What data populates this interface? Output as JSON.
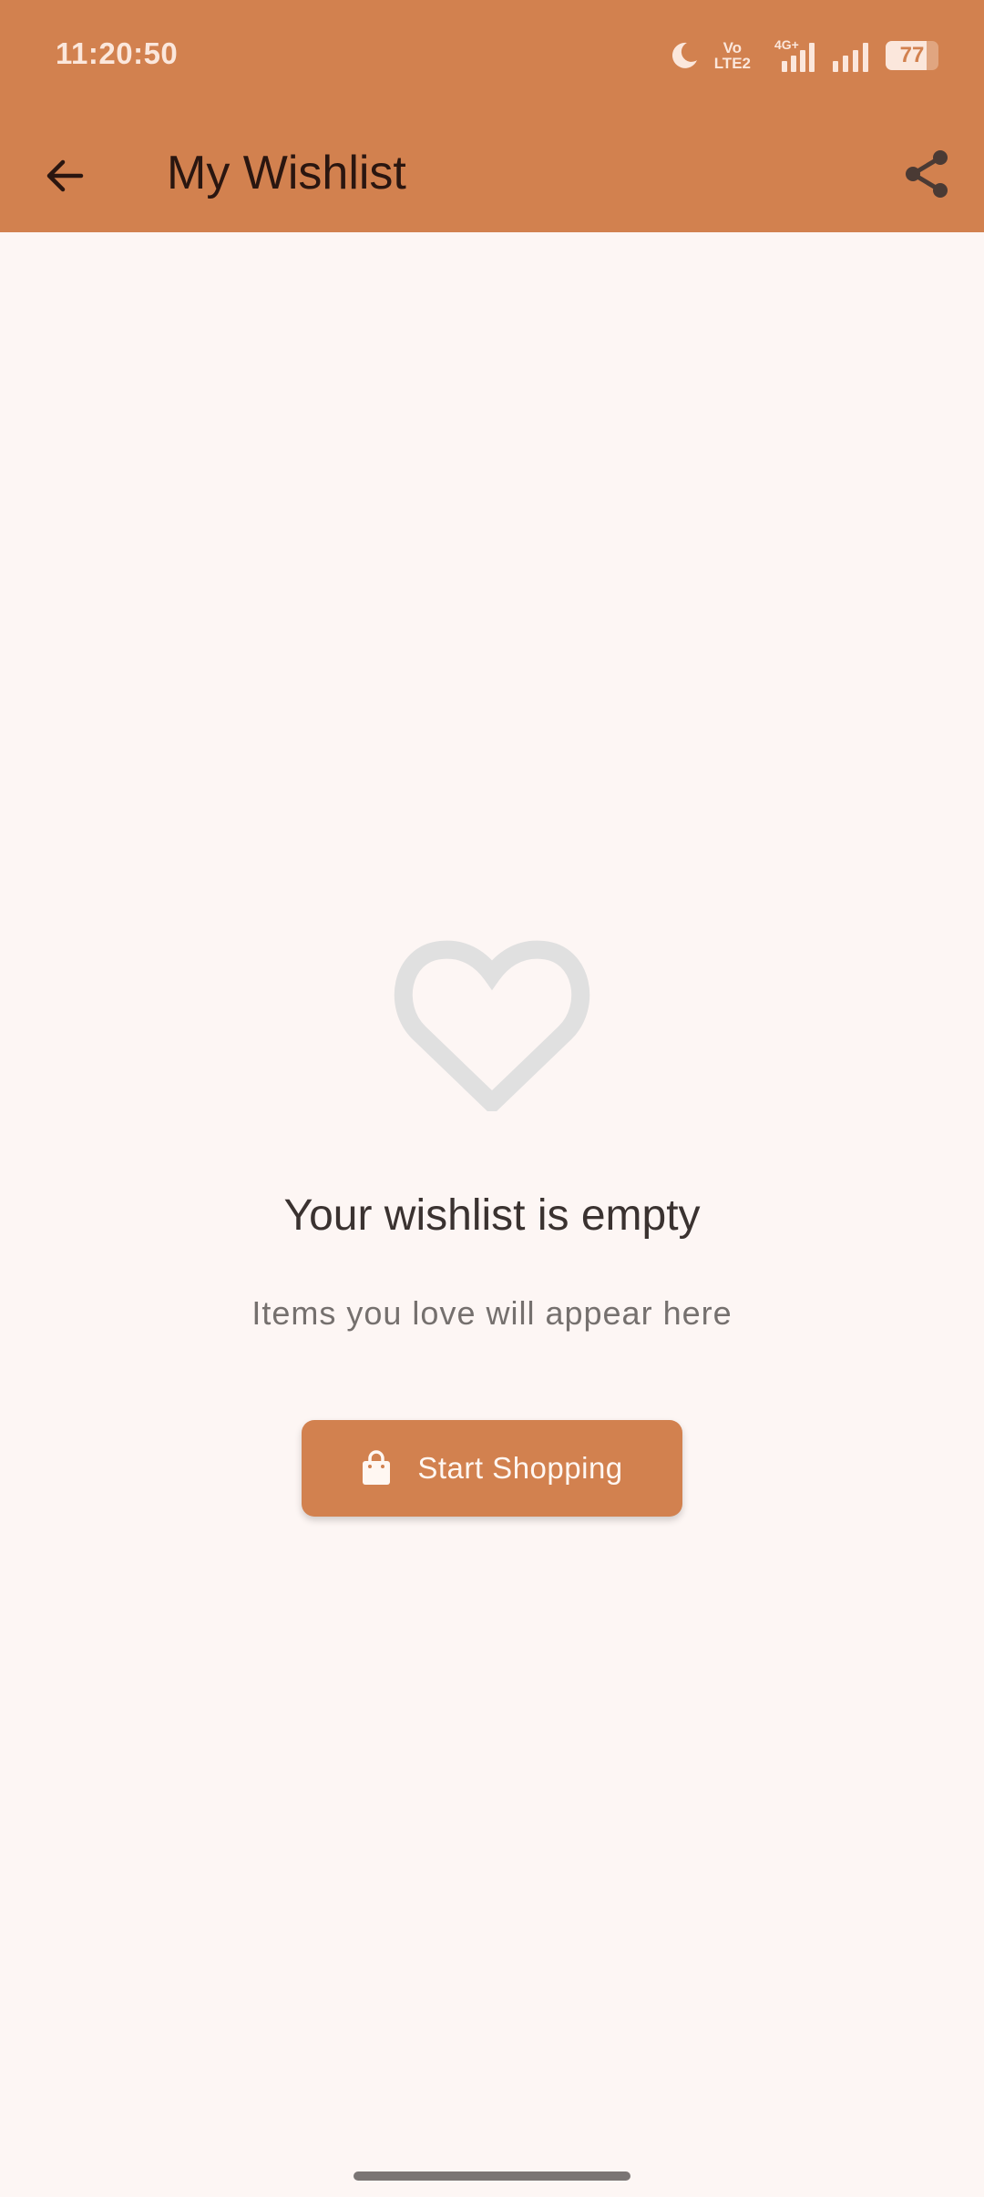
{
  "status_bar": {
    "time": "11:20:50",
    "volte_line1": "Vo",
    "volte_line2": "LTE2",
    "network": "4G+",
    "battery": "77",
    "battery_level": 0.77
  },
  "toolbar": {
    "back_icon": "arrow-back-icon",
    "title": "My Wishlist",
    "share_icon": "share-icon"
  },
  "empty_state": {
    "icon": "heart-outline-icon",
    "title": "Your wishlist is empty",
    "subtitle": "Items you love will appear here",
    "button_label": "Start Shopping",
    "button_icon": "shopping-bag-icon"
  },
  "colors": {
    "primary": "#d2814f",
    "background": "#fdf6f4",
    "heart": "#e0e0e0"
  }
}
